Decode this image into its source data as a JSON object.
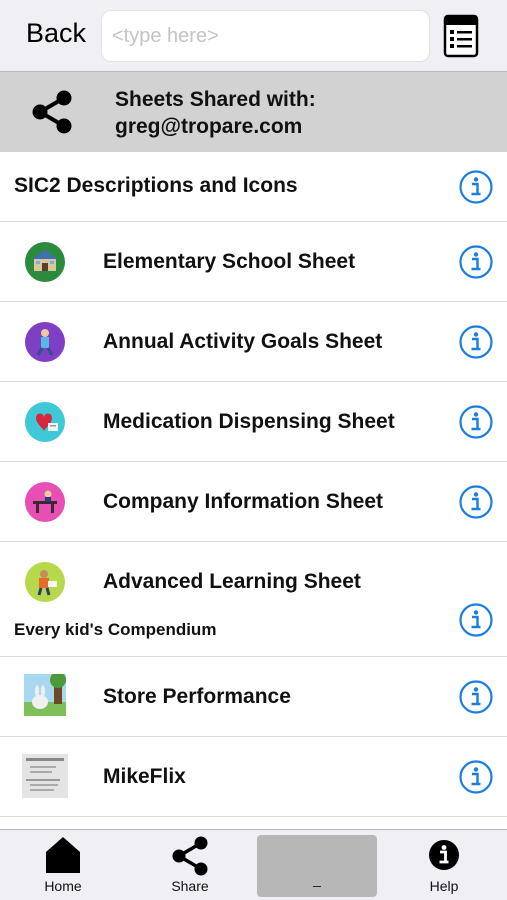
{
  "topbar": {
    "back_label": "Back",
    "search_placeholder": "<type here>",
    "sheet_icon": "spreadsheet-list-icon"
  },
  "shared": {
    "line1": "Sheets Shared with:",
    "line2": "greg@tropare.com",
    "icon": "share-icon"
  },
  "list": {
    "group1_title": "SIC2 Descriptions and Icons",
    "items": [
      {
        "label": "Elementary School Sheet",
        "icon": "school-thumbnail"
      },
      {
        "label": "Annual Activity Goals Sheet",
        "icon": "activity-thumbnail"
      },
      {
        "label": "Medication Dispensing Sheet",
        "icon": "medication-thumbnail"
      },
      {
        "label": "Company Information Sheet",
        "icon": "company-thumbnail"
      },
      {
        "label": "Advanced Learning Sheet",
        "icon": "learning-thumbnail"
      }
    ],
    "section2_label": "Every kid's Compendium",
    "items2": [
      {
        "label": "Store Performance",
        "icon": "store-thumbnail"
      },
      {
        "label": "MikeFlix",
        "icon": "mikeflix-thumbnail"
      }
    ]
  },
  "tabbar": {
    "home": "Home",
    "share": "Share",
    "blank": "_",
    "help": "Help"
  },
  "colors": {
    "accent_blue": "#1a7ee0",
    "header_gray": "#d2d2d2",
    "bar_gray": "#efeff4"
  }
}
